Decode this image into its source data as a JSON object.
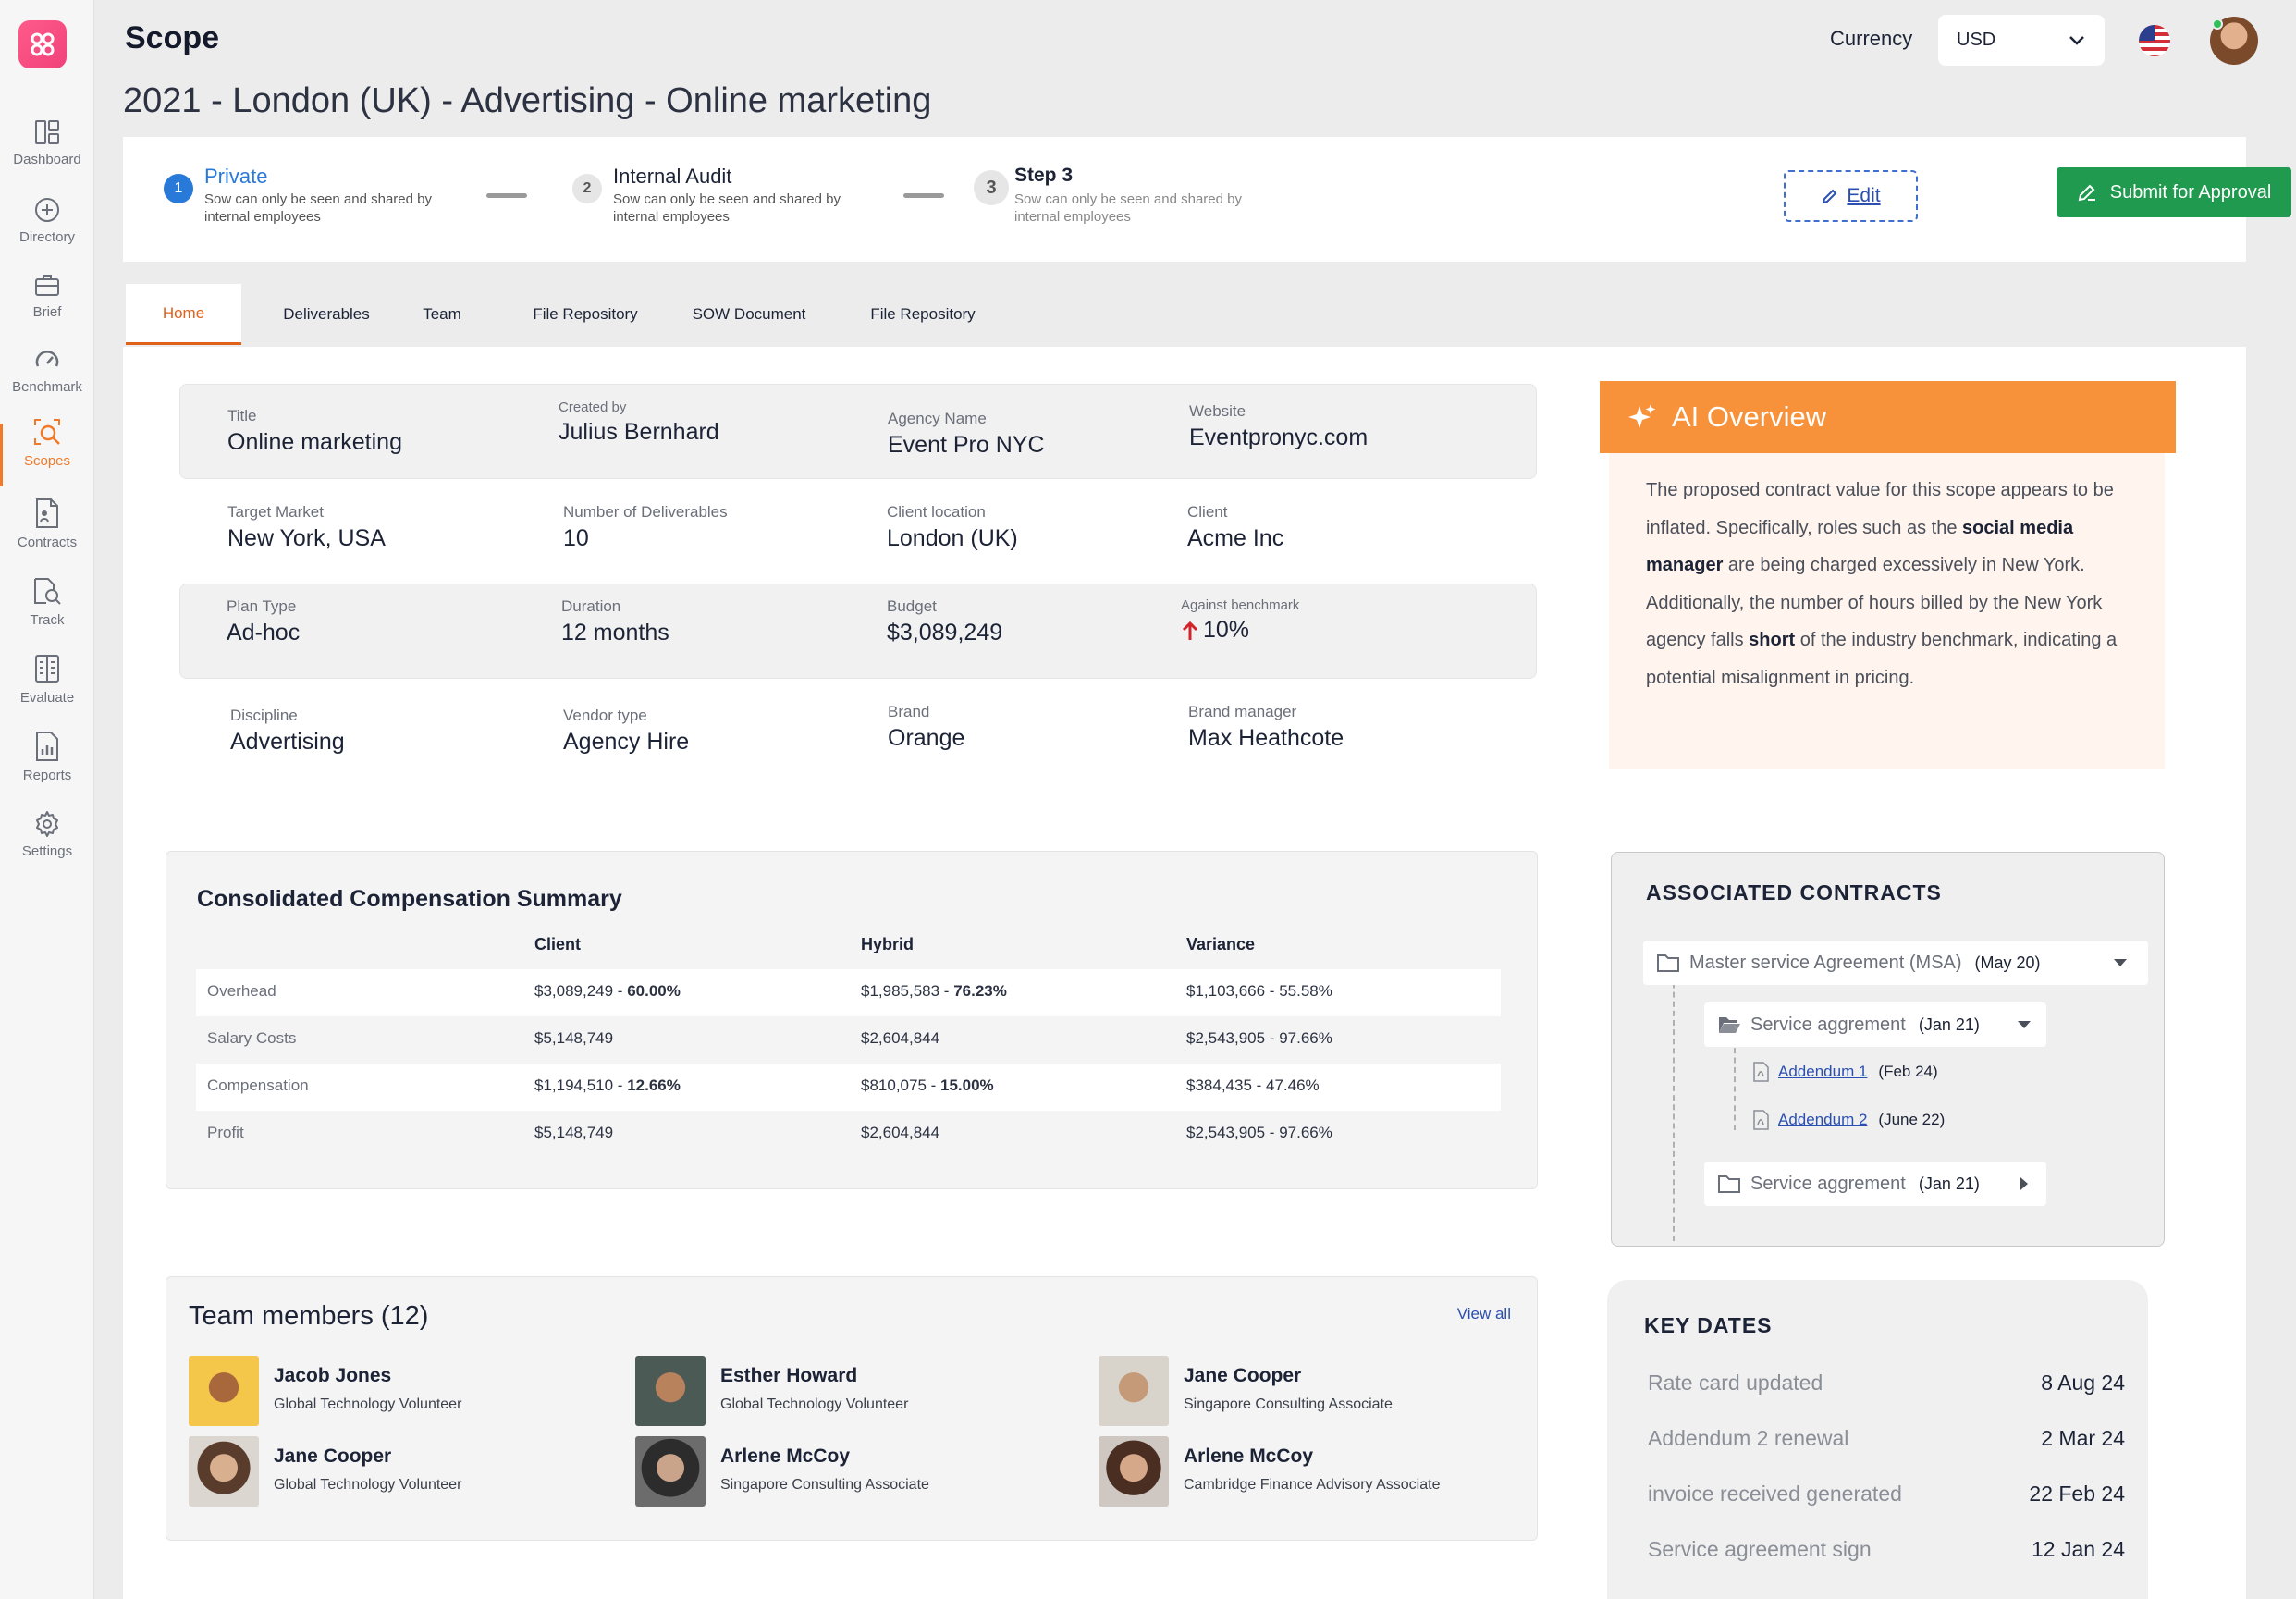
{
  "app": {
    "title": "Scope"
  },
  "sidebar": {
    "items": [
      {
        "label": "Dashboard",
        "icon": "dashboard-icon"
      },
      {
        "label": "Directory",
        "icon": "plus-circle-icon"
      },
      {
        "label": "Brief",
        "icon": "briefcase-icon"
      },
      {
        "label": "Benchmark",
        "icon": "gauge-icon"
      },
      {
        "label": "Scopes",
        "icon": "scope-search-icon",
        "active": true
      },
      {
        "label": "Contracts",
        "icon": "contract-icon"
      },
      {
        "label": "Track",
        "icon": "track-icon"
      },
      {
        "label": "Evaluate",
        "icon": "evaluate-icon"
      },
      {
        "label": "Reports",
        "icon": "reports-icon"
      },
      {
        "label": "Settings",
        "icon": "gear-icon"
      }
    ]
  },
  "header": {
    "currency_label": "Currency",
    "currency_value": "USD",
    "page_heading": "2021 - London (UK)  - Advertising - Online marketing"
  },
  "steps": [
    {
      "num": "1",
      "title": "Private",
      "desc": "Sow can only be seen and shared by internal employees",
      "active": true
    },
    {
      "num": "2",
      "title": "Internal Audit",
      "desc": "Sow can only be seen and shared by internal employees"
    },
    {
      "num": "3",
      "title": "Step 3",
      "desc": "Sow can only be seen and shared by internal employees"
    }
  ],
  "actions": {
    "edit": "Edit",
    "submit": "Submit for Approval"
  },
  "tabs": [
    "Home",
    "Deliverables",
    "Team",
    "File Repository",
    "SOW Document",
    "File Repository"
  ],
  "info": {
    "title": {
      "k": "Title",
      "v": "Online marketing"
    },
    "created_by": {
      "k": "Created by",
      "v": "Julius Bernhard"
    },
    "agency_name": {
      "k": "Agency Name",
      "v": "Event Pro NYC"
    },
    "website": {
      "k": "Website",
      "v": "Eventpronyc.com"
    },
    "target_market": {
      "k": "Target Market",
      "v": "New York, USA"
    },
    "num_deliverables": {
      "k": "Number of Deliverables",
      "v": "10"
    },
    "client_location": {
      "k": "Client location",
      "v": "London (UK)"
    },
    "client": {
      "k": "Client",
      "v": "Acme Inc"
    },
    "plan_type": {
      "k": "Plan Type",
      "v": "Ad-hoc"
    },
    "duration": {
      "k": "Duration",
      "v": "12 months"
    },
    "budget": {
      "k": "Budget",
      "v": "$3,089,249"
    },
    "benchmark": {
      "k": "Against benchmark",
      "v": "10%"
    },
    "discipline": {
      "k": "Discipline",
      "v": "Advertising"
    },
    "vendor_type": {
      "k": "Vendor type",
      "v": "Agency Hire"
    },
    "brand": {
      "k": "Brand",
      "v": "Orange"
    },
    "brand_manager": {
      "k": "Brand manager",
      "v": "Max Heathcote"
    }
  },
  "ai": {
    "title": "AI Overview",
    "p1": "The proposed contract value for this scope appears to be inflated. Specifically, roles such as the ",
    "b1": "social media manager",
    "p2": " are being charged excessively in New York. Additionally, the number of hours billed by the New York agency falls ",
    "b2": "short",
    "p3": " of the industry benchmark, indicating a potential misalignment in pricing."
  },
  "comp": {
    "title": "Consolidated Compensation Summary",
    "headers": [
      "Client",
      "Hybrid",
      "Variance"
    ],
    "rows": [
      {
        "label": "Overhead",
        "client": "$3,089,249 - ",
        "client_b": " 60.00%",
        "hybrid": "$1,985,583 - ",
        "hybrid_b": "76.23%",
        "variance": "$1,103,666 - 55.58%"
      },
      {
        "label": "Salary Costs",
        "client": "$5,148,749",
        "client_b": "",
        "hybrid": "$2,604,844",
        "hybrid_b": "",
        "variance": "$2,543,905 - 97.66%"
      },
      {
        "label": "Compensation",
        "client": "$1,194,510 - ",
        "client_b": "12.66%",
        "hybrid": "$810,075 - ",
        "hybrid_b": "15.00%",
        "variance": "$384,435 - 47.46%"
      },
      {
        "label": "Profit",
        "client": "$5,148,749",
        "client_b": "",
        "hybrid": "$2,604,844",
        "hybrid_b": "",
        "variance": "$2,543,905 - 97.66%"
      }
    ]
  },
  "team": {
    "title": "Team members (12)",
    "view_all": "View all",
    "members": [
      {
        "name": "Jacob Jones",
        "role": "Global Technology Volunteer"
      },
      {
        "name": "Esther Howard",
        "role": "Global Technology Volunteer"
      },
      {
        "name": "Jane Cooper",
        "role": "Singapore Consulting Associate"
      },
      {
        "name": "Jane Cooper",
        "role": "Global Technology Volunteer"
      },
      {
        "name": "Arlene McCoy",
        "role": "Singapore Consulting Associate"
      },
      {
        "name": "Arlene McCoy",
        "role": "Cambridge Finance Advisory Associate"
      }
    ]
  },
  "contracts": {
    "title": "ASSOCIATED CONTRACTS",
    "msa": {
      "label": "Master service Agreement (MSA)",
      "date": "(May 20)"
    },
    "sa1": {
      "label": "Service aggrement",
      "date": "(Jan 21)"
    },
    "add1": {
      "label": "Addendum 1",
      "date": "(Feb 24)"
    },
    "add2": {
      "label": "Addendum 2",
      "date": "(June 22)"
    },
    "sa2": {
      "label": "Service aggrement",
      "date": "(Jan 21)"
    }
  },
  "keydates": {
    "title": "KEY DATES",
    "rows": [
      {
        "k": "Rate card updated",
        "v": "8 Aug 24"
      },
      {
        "k": "Addendum 2 renewal",
        "v": "2 Mar 24"
      },
      {
        "k": "invoice received generated",
        "v": "22 Feb 24"
      },
      {
        "k": "Service agreement sign",
        "v": "12 Jan 24"
      }
    ]
  },
  "colors": {
    "accent": "#f07a2a",
    "primary": "#2979d8",
    "success": "#1f9a4f",
    "ai_header": "#f7923a"
  }
}
